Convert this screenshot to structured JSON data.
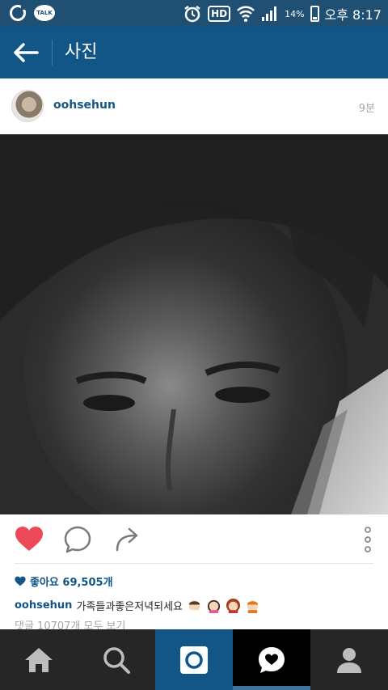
{
  "status_bar": {
    "talk_label": "TALK",
    "hd_label": "HD",
    "battery_percent": "14%",
    "time": "오후 8:17"
  },
  "header": {
    "title": "사진"
  },
  "post": {
    "username": "oohsehun",
    "time_ago": "9분",
    "likes_text": "좋아요 69,505개",
    "caption_text": "가족들과좋은저녁되세요",
    "comments_link": "댓글 10707개 모두 보기",
    "liked": true
  },
  "colors": {
    "brand_blue": "#125688",
    "status_bar": "#1f4f72",
    "like_red": "#ed4956",
    "nav_bg": "#262626"
  },
  "icons": {
    "back": "arrow-left-icon",
    "like": "heart-icon",
    "comment": "comment-bubble-icon",
    "share": "share-arrow-icon",
    "more": "vertical-dots-icon",
    "nav_home": "home-icon",
    "nav_explore": "search-icon",
    "nav_camera": "camera-icon",
    "nav_activity": "heart-bubble-icon",
    "nav_profile": "person-icon"
  }
}
